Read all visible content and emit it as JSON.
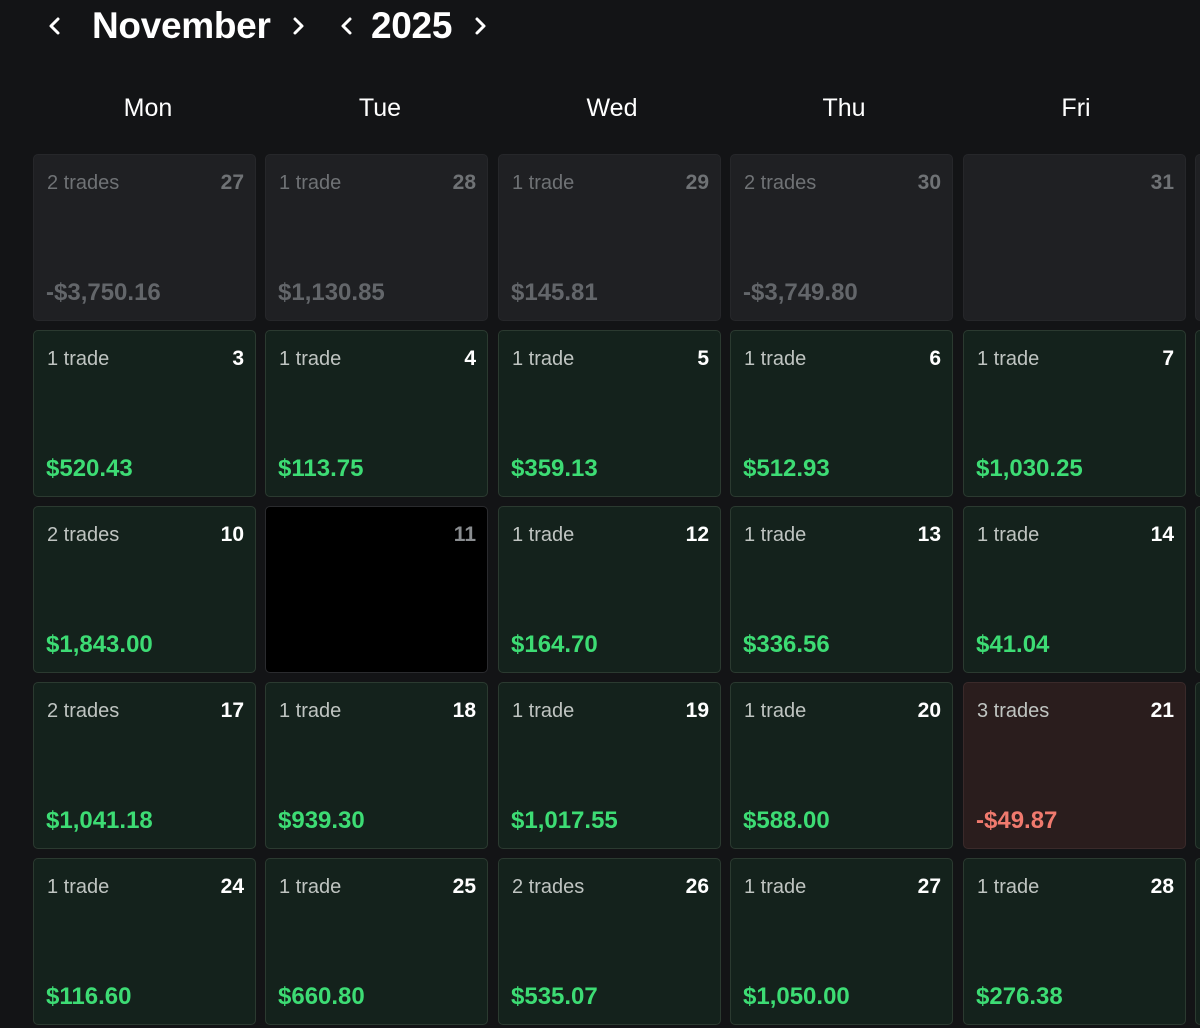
{
  "header": {
    "month": "November",
    "year": "2025",
    "prev_month_icon": "chevron-left-icon",
    "next_month_icon": "chevron-right-icon",
    "prev_year_icon": "chevron-left-icon",
    "next_year_icon": "chevron-right-icon"
  },
  "weekdays": [
    "Mon",
    "Tue",
    "Wed",
    "Thu",
    "Fri"
  ],
  "colors": {
    "background": "#131416",
    "profit": "#3ddc74",
    "loss": "#f07a6e",
    "profit_cell": "#14221c",
    "loss_cell": "#2a1d1d",
    "outside_cell": "#1f2023"
  },
  "weeks": [
    [
      {
        "day": "27",
        "trades": "2 trades",
        "pnl": "-$3,750.16",
        "state": "outside"
      },
      {
        "day": "28",
        "trades": "1 trade",
        "pnl": "$1,130.85",
        "state": "outside"
      },
      {
        "day": "29",
        "trades": "1 trade",
        "pnl": "$145.81",
        "state": "outside"
      },
      {
        "day": "30",
        "trades": "2 trades",
        "pnl": "-$3,749.80",
        "state": "outside"
      },
      {
        "day": "31",
        "trades": "",
        "pnl": "",
        "state": "outside"
      }
    ],
    [
      {
        "day": "3",
        "trades": "1 trade",
        "pnl": "$520.43",
        "state": "profit"
      },
      {
        "day": "4",
        "trades": "1 trade",
        "pnl": "$113.75",
        "state": "profit"
      },
      {
        "day": "5",
        "trades": "1 trade",
        "pnl": "$359.13",
        "state": "profit"
      },
      {
        "day": "6",
        "trades": "1 trade",
        "pnl": "$512.93",
        "state": "profit"
      },
      {
        "day": "7",
        "trades": "1 trade",
        "pnl": "$1,030.25",
        "state": "profit"
      }
    ],
    [
      {
        "day": "10",
        "trades": "2 trades",
        "pnl": "$1,843.00",
        "state": "profit"
      },
      {
        "day": "11",
        "trades": "",
        "pnl": "",
        "state": "empty"
      },
      {
        "day": "12",
        "trades": "1 trade",
        "pnl": "$164.70",
        "state": "profit"
      },
      {
        "day": "13",
        "trades": "1 trade",
        "pnl": "$336.56",
        "state": "profit"
      },
      {
        "day": "14",
        "trades": "1 trade",
        "pnl": "$41.04",
        "state": "profit"
      }
    ],
    [
      {
        "day": "17",
        "trades": "2 trades",
        "pnl": "$1,041.18",
        "state": "profit"
      },
      {
        "day": "18",
        "trades": "1 trade",
        "pnl": "$939.30",
        "state": "profit"
      },
      {
        "day": "19",
        "trades": "1 trade",
        "pnl": "$1,017.55",
        "state": "profit"
      },
      {
        "day": "20",
        "trades": "1 trade",
        "pnl": "$588.00",
        "state": "profit"
      },
      {
        "day": "21",
        "trades": "3 trades",
        "pnl": "-$49.87",
        "state": "loss"
      }
    ],
    [
      {
        "day": "24",
        "trades": "1 trade",
        "pnl": "$116.60",
        "state": "profit"
      },
      {
        "day": "25",
        "trades": "1 trade",
        "pnl": "$660.80",
        "state": "profit"
      },
      {
        "day": "26",
        "trades": "2 trades",
        "pnl": "$535.07",
        "state": "profit"
      },
      {
        "day": "27",
        "trades": "1 trade",
        "pnl": "$1,050.00",
        "state": "profit"
      },
      {
        "day": "28",
        "trades": "1 trade",
        "pnl": "$276.38",
        "state": "profit"
      }
    ]
  ]
}
